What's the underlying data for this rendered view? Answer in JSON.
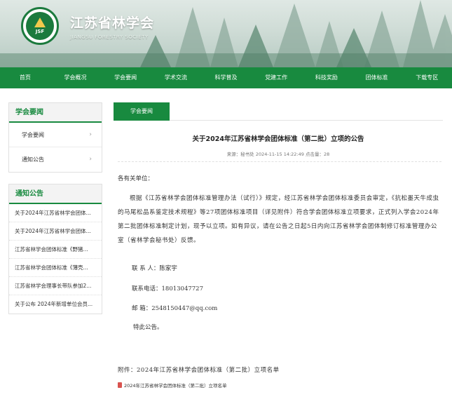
{
  "site": {
    "title_cn": "江苏省林学会",
    "title_en": "JIANGSU FORESTRY SOCIETY",
    "logo_text": "JSF"
  },
  "nav": [
    "首页",
    "学会概况",
    "学会要闻",
    "学术交流",
    "科学普及",
    "党建工作",
    "科技奖励",
    "团体标准",
    "下载专区"
  ],
  "sidebar": {
    "menu_title": "学会要闻",
    "menu_items": [
      "学会要闻",
      "通知公告"
    ],
    "notice_title": "通知公告",
    "notices": [
      "关于2024年江苏省林学会团体...",
      "关于2024年江苏省林学会团体...",
      "江苏省林学会团体标准《野猪...",
      "江苏省林学会团体标准《薄壳...",
      "江苏省林学会理事长带队参加2...",
      "关于公布 2024年新增单位会员..."
    ]
  },
  "main": {
    "tab_label": "学会要闻",
    "article_title": "关于2024年江苏省林学会团体标准（第二批）立项的公告",
    "meta": "来源：秘书处   2024-11-15 14:22:49 点击量：28",
    "salutation": "各有关单位：",
    "paragraph": "根据《江苏省林学会团体标准管理办法（试行）》规定，经江苏省林学会团体标准委员会审定，《抗松墨天牛成虫的马尾松品系鉴定技术规程》等27项团体标准项目（详见附件）符合学会团体标准立项要求，正式列入学会2024年第二批团体标准制定计划，现予以立项。如有异议，请在公告之日起5日内向江苏省林学会团体制修订标准管理办公室（省林学会秘书处）反馈。",
    "contact_person": "联 系 人：陈家宇",
    "contact_phone": "联系电话：18013047727",
    "contact_email": "邮    箱：2548150447@qq.com",
    "closing": "特此公告。",
    "attachment": "附件：2024年江苏省林学会团体标准（第二批）立项名单",
    "file_name": "2024年江苏省林学会团体标准（第二批）立项名单"
  },
  "colors": {
    "brand_green": "#188a3f"
  }
}
